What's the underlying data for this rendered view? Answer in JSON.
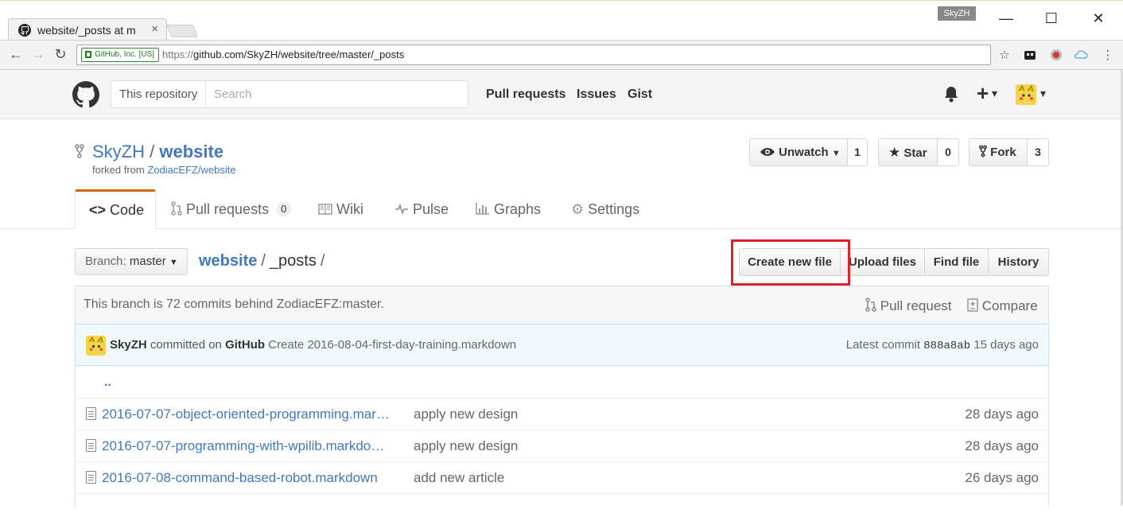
{
  "browser": {
    "tab_title": "website/_posts at m",
    "tab_close": "×",
    "profile_name": "SkyZH",
    "minimize": "—",
    "maximize": "☐",
    "close": "✕",
    "back": "←",
    "forward": "→",
    "reload": "↻",
    "secure_label": "GitHub, Inc. [US]",
    "url_scheme": "https://",
    "url_rest": "github.com/SkyZH/website/tree/master/_posts"
  },
  "gh_header": {
    "search_scope": "This repository",
    "search_placeholder": "Search",
    "nav": [
      "Pull requests",
      "Issues",
      "Gist"
    ],
    "plus": "+",
    "caret": "▾"
  },
  "repo": {
    "owner": "SkyZH",
    "sep": "/",
    "name": "website",
    "forked_prefix": "forked from",
    "forked_from": "ZodiacEFZ/website",
    "watch_label": "Unwatch",
    "watch_count": "1",
    "star_label": "Star",
    "star_count": "0",
    "fork_label": "Fork",
    "fork_count": "3"
  },
  "repo_tabs": {
    "code": "Code",
    "pulls": "Pull requests",
    "pulls_count": "0",
    "wiki": "Wiki",
    "pulse": "Pulse",
    "graphs": "Graphs",
    "settings": "Settings"
  },
  "file_nav": {
    "branch_label": "Branch:",
    "branch_value": "master",
    "root": "website",
    "path": "_posts",
    "create_new_file": "Create new file",
    "upload_files": "Upload files",
    "find_file": "Find file",
    "history": "History"
  },
  "behind": {
    "message": "This branch is 72 commits behind ZodiacEFZ:master.",
    "pull_request": "Pull request",
    "compare": "Compare"
  },
  "commit": {
    "author": "SkyZH",
    "committed_on": "committed on",
    "via": "GitHub",
    "message": "Create 2016-08-04-first-day-training.markdown",
    "latest_label": "Latest commit",
    "sha": "888a8ab",
    "age": "15 days ago"
  },
  "files": {
    "parent": "..",
    "rows": [
      {
        "name": "2016-07-07-object-oriented-programming.mar…",
        "message": "apply new design",
        "age": "28 days ago"
      },
      {
        "name": "2016-07-07-programming-with-wpilib.markdo…",
        "message": "apply new design",
        "age": "28 days ago"
      },
      {
        "name": "2016-07-08-command-based-robot.markdown",
        "message": "add new article",
        "age": "26 days ago"
      }
    ]
  },
  "colors": {
    "link": "#4078c0",
    "tab_accent": "#d26911",
    "highlight": "#e0202a"
  }
}
